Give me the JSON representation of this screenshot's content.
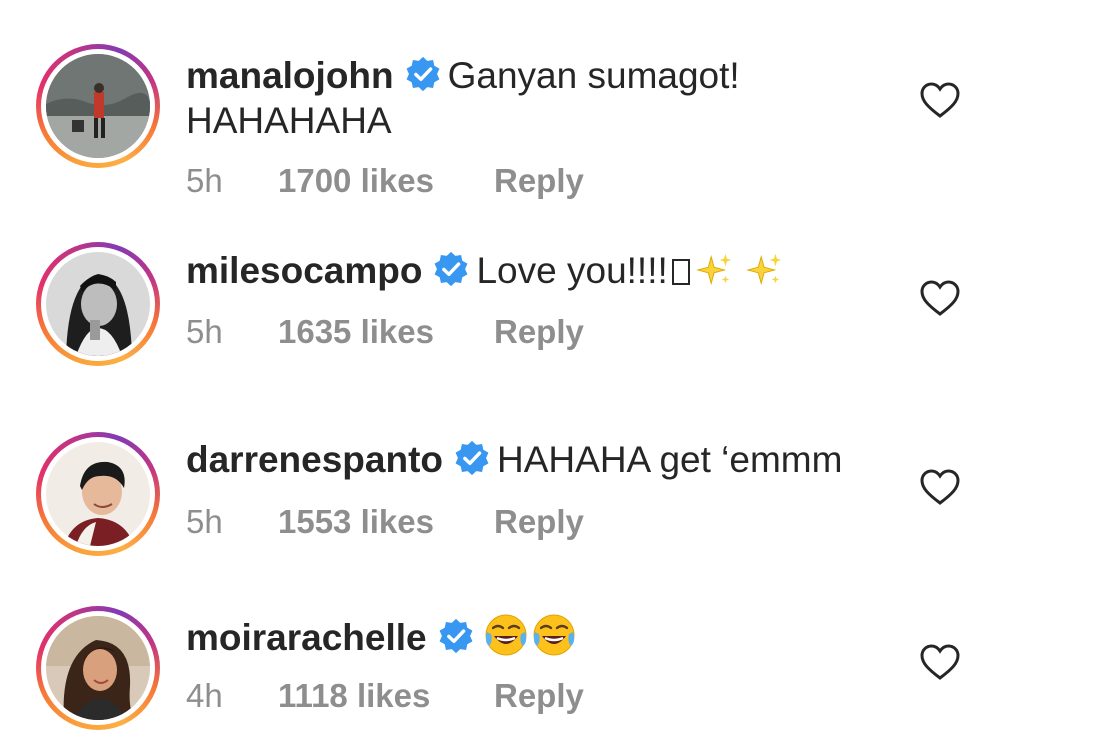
{
  "comments": [
    {
      "username": "manalojohn",
      "text_line1": "Ganyan sumagot!",
      "text_line2": "HAHAHAHA",
      "time": "5h",
      "likes": "1700 likes",
      "reply": "Reply"
    },
    {
      "username": "milesocampo",
      "text_line1": "Love you!!!!",
      "emojis": [
        "unsupported-glyph-box",
        "sparkles",
        "sparkles"
      ],
      "time": "5h",
      "likes": "1635 likes",
      "reply": "Reply"
    },
    {
      "username": "darrenespanto",
      "text_line1": "HAHAHA get ‘emmm",
      "time": "5h",
      "likes": "1553 likes",
      "reply": "Reply"
    },
    {
      "username": "moirarachelle",
      "emojis": [
        "face-with-tears-of-joy",
        "face-with-tears-of-joy"
      ],
      "time": "4h",
      "likes": "1118 likes",
      "reply": "Reply"
    }
  ],
  "colors": {
    "verified": "#3897f0",
    "meta_text": "#8e8e8e",
    "text": "#262626",
    "story_ring_start": "#fcaf45",
    "story_ring_end": "#c13584"
  }
}
